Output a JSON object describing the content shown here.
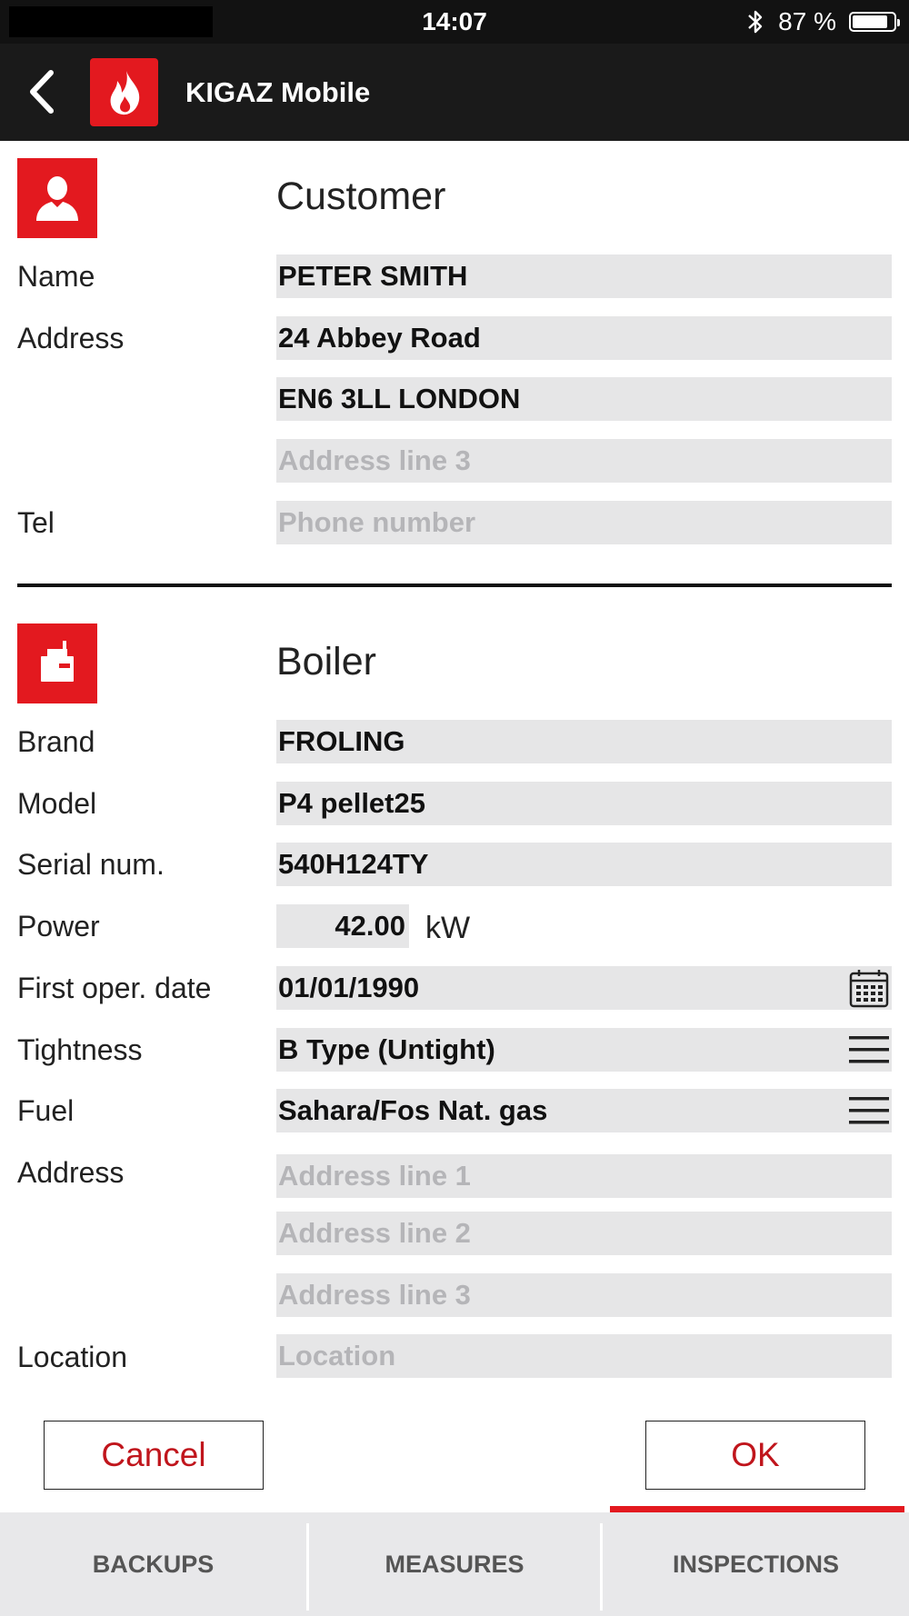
{
  "status": {
    "time": "14:07",
    "battery": "87 %",
    "battery_level": 0.87
  },
  "header": {
    "title": "KIGAZ Mobile"
  },
  "customer": {
    "title": "Customer",
    "name_label": "Name",
    "name_value": "PETER SMITH",
    "address_label": "Address",
    "address_line1": "24 Abbey Road",
    "address_line2": "EN6 3LL LONDON",
    "address_line3_placeholder": "Address line 3",
    "tel_label": "Tel",
    "tel_placeholder": "Phone number"
  },
  "boiler": {
    "title": "Boiler",
    "brand_label": "Brand",
    "brand_value": "FROLING",
    "model_label": "Model",
    "model_value": "P4 pellet25",
    "serial_label": "Serial num.",
    "serial_value": "540H124TY",
    "power_label": "Power",
    "power_value": "42.00",
    "power_unit": "kW",
    "first_oper_label": "First oper. date",
    "first_oper_value": "01/01/1990",
    "tightness_label": "Tightness",
    "tightness_value": "B Type (Untight)",
    "fuel_label": "Fuel",
    "fuel_value": "Sahara/Fos Nat. gas",
    "address_label": "Address",
    "address_line1_placeholder": "Address line 1",
    "address_line2_placeholder": "Address line 2",
    "address_line3_placeholder": "Address line 3",
    "location_label": "Location",
    "location_placeholder": "Location"
  },
  "actions": {
    "cancel": "Cancel",
    "ok": "OK"
  },
  "tabs": [
    {
      "label": "BACKUPS"
    },
    {
      "label": "MEASURES"
    },
    {
      "label": "INSPECTIONS",
      "active": true
    }
  ],
  "colors": {
    "accent": "#e3191f",
    "button_text": "#c0151c",
    "header_bg": "#1a1a1a",
    "field_bg": "#e6e6e7"
  },
  "icons": {
    "back": "chevron-left-icon",
    "logo": "flame-icon",
    "customer": "user-icon",
    "boiler": "boiler-icon",
    "calendar": "calendar-icon",
    "dropdown": "menu-icon"
  }
}
